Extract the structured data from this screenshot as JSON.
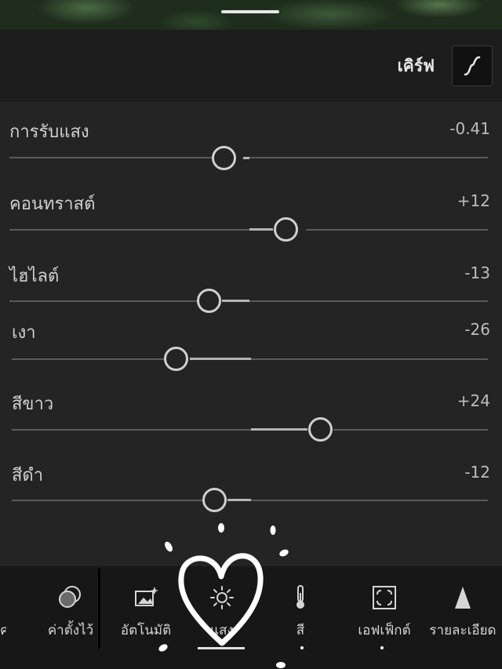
{
  "header": {
    "title": "เคิร์ฟ"
  },
  "sliders": [
    {
      "label": "การรับแสง",
      "value": "-0.41",
      "level": -0.41
    },
    {
      "label": "คอนทราสต์",
      "value": "+12",
      "level": 12
    },
    {
      "label": "ไฮไลต์",
      "value": "-13",
      "level": -13
    },
    {
      "label": "เงา",
      "value": "-26",
      "level": -26
    },
    {
      "label": "สีขาว",
      "value": "+24",
      "level": 24
    },
    {
      "label": "สีดำ",
      "value": "-12",
      "level": -12
    }
  ],
  "tabs": [
    {
      "label": "ค่าตั้งไว้",
      "icon": "presets-icon"
    },
    {
      "label": "อัตโนมัติ",
      "icon": "auto-icon"
    },
    {
      "label": "แสง",
      "icon": "sun-icon",
      "selected": true
    },
    {
      "label": "สี",
      "icon": "thermometer-icon"
    },
    {
      "label": "เอฟเฟ็กต์",
      "icon": "effects-icon"
    },
    {
      "label": "รายละเอียด",
      "icon": "detail-icon"
    }
  ],
  "colors": {
    "accent": "#e0e0e0",
    "background": "#242424",
    "track": "#5a5a5a"
  }
}
